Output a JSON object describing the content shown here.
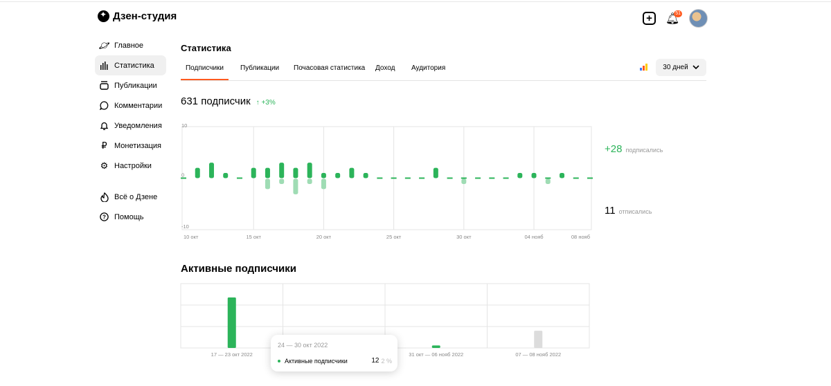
{
  "app": {
    "logo_text": "Дзен-студия",
    "notification_count": "51"
  },
  "sidebar": {
    "items": [
      {
        "label": "Главное",
        "icon": "planet-icon"
      },
      {
        "label": "Статистика",
        "icon": "bar-chart-icon",
        "active": true
      },
      {
        "label": "Публикации",
        "icon": "publications-icon"
      },
      {
        "label": "Комментарии",
        "icon": "comment-icon"
      },
      {
        "label": "Уведомления",
        "icon": "bell-icon"
      },
      {
        "label": "Монетизация",
        "icon": "ruble-icon"
      },
      {
        "label": "Настройки",
        "icon": "gear-icon"
      }
    ],
    "secondary": [
      {
        "label": "Всё о Дзене",
        "icon": "flame-icon"
      },
      {
        "label": "Помощь",
        "icon": "help-icon"
      }
    ]
  },
  "page": {
    "title": "Статистика",
    "tabs": [
      "Подписчики",
      "Публикации",
      "Почасовая статистика",
      "Доход",
      "Аудитория"
    ],
    "period": "30 дней"
  },
  "subscribers": {
    "count_text": "631 подписчик",
    "growth": "↑ +3%",
    "subscribed_num": "+28",
    "subscribed_label": "подписались",
    "unsubscribed_num": "11",
    "unsubscribed_label": "отписались"
  },
  "active": {
    "title": "Активные подписчики"
  },
  "tooltip": {
    "date": "24 — 30 окт 2022",
    "label": "Активные подписчики",
    "value": "12",
    "percent": "2 %"
  },
  "colors": {
    "green": "#2cb45a",
    "green_light": "#9fdcb4",
    "accent": "#ff5a1f",
    "grey_bar": "#dcdcdc"
  },
  "chart_data": [
    {
      "type": "bar",
      "title": "",
      "ylim": [
        -10,
        10
      ],
      "y_ticks": [
        "10",
        "0",
        "-10"
      ],
      "x_tick_labels": [
        "10 окт",
        "15 окт",
        "20 окт",
        "25 окт",
        "30 окт",
        "04 нояб",
        "08 нояб"
      ],
      "x": [
        "10 окт",
        "11 окт",
        "12 окт",
        "13 окт",
        "14 окт",
        "15 окт",
        "16 окт",
        "17 окт",
        "18 окт",
        "19 окт",
        "20 окт",
        "21 окт",
        "22 окт",
        "23 окт",
        "24 окт",
        "25 окт",
        "26 окт",
        "27 окт",
        "28 окт",
        "29 окт",
        "30 окт",
        "31 окт",
        "01 нояб",
        "02 нояб",
        "03 нояб",
        "04 нояб",
        "05 нояб",
        "06 нояб",
        "07 нояб",
        "08 нояб"
      ],
      "series": [
        {
          "values": [
            0,
            2,
            3,
            1,
            0,
            2,
            2,
            3,
            2,
            3,
            1,
            1,
            2,
            1,
            0,
            0,
            0,
            0,
            2,
            0,
            0,
            0,
            0,
            0,
            1,
            1,
            0,
            1,
            0,
            0
          ]
        },
        {
          "values": [
            0,
            0,
            0,
            0,
            0,
            0,
            -2,
            -1,
            -3,
            -1,
            -2,
            0,
            0,
            0,
            0,
            0,
            0,
            0,
            0,
            0,
            -1,
            0,
            0,
            0,
            0,
            0,
            -1,
            0,
            0,
            0
          ]
        }
      ]
    },
    {
      "type": "bar",
      "title": "Активные подписчики",
      "categories": [
        "17 — 23 окт 2022",
        "24 — 30 окт 2022",
        "31 окт — 06 нояб 2022",
        "07 — 08 нояб 2022"
      ],
      "values": [
        100,
        12,
        5,
        34
      ],
      "highlighted": "24 — 30 окт 2022",
      "partial": "07 — 08 нояб 2022"
    }
  ]
}
